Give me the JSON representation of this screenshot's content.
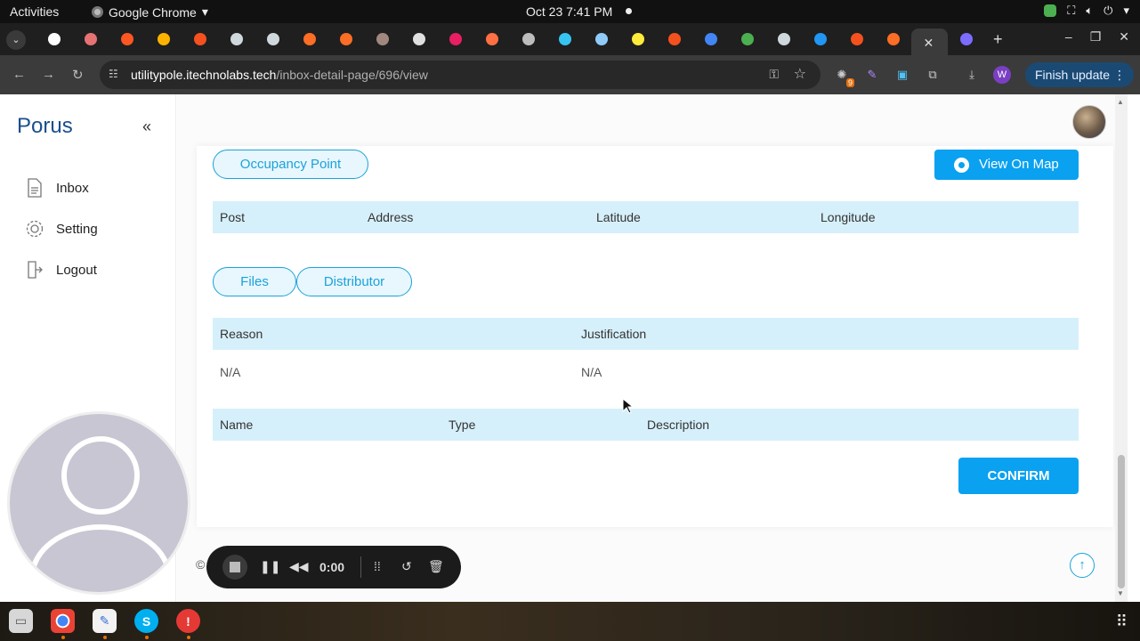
{
  "system_bar": {
    "activities": "Activities",
    "app_name": "Google Chrome",
    "app_menu_arrow": "▾",
    "clock": "Oct 23  7:41 PM",
    "tray_icons": [
      "shield-icon",
      "network-icon",
      "volume-icon",
      "power-icon"
    ]
  },
  "browser": {
    "tab_menu": "⌄",
    "tab_favicons": [
      {
        "color": "#ffffff"
      },
      {
        "color": "#e57373"
      },
      {
        "color": "#ff5722"
      },
      {
        "color": "#ffb300"
      },
      {
        "color": "#f4511e"
      },
      {
        "color": "#cfd8dc"
      },
      {
        "color": "#cfd8dc"
      },
      {
        "color": "#fc6d26"
      },
      {
        "color": "#fc6d26"
      },
      {
        "color": "#a1887f"
      },
      {
        "color": "#e0e0e0"
      },
      {
        "color": "#e91e63"
      },
      {
        "color": "#ff7043"
      },
      {
        "color": "#bdbdbd"
      },
      {
        "color": "#36c5f0"
      },
      {
        "color": "#90caf9"
      },
      {
        "color": "#ffeb3b"
      },
      {
        "color": "#f4511e"
      },
      {
        "color": "#4285f4"
      },
      {
        "color": "#4caf50"
      },
      {
        "color": "#cfd8dc"
      },
      {
        "color": "#2196f3"
      },
      {
        "color": "#f4511e"
      },
      {
        "color": "#fc6d26"
      }
    ],
    "active_tab_close": "✕",
    "newtab_label": "+",
    "window_controls": [
      "–",
      "❐",
      "✕"
    ],
    "back": "←",
    "forward": "→",
    "reload": "↻",
    "url_host": "utilitypole.itechnolabs.tech",
    "url_path": "/inbox-detail-page/696/view",
    "ext_badge": "9",
    "profile_letter": "W",
    "finish_update": "Finish update",
    "menu_dots": "⋮"
  },
  "sidebar": {
    "brand": "Porus",
    "collapse": "«",
    "items": [
      {
        "label": "Inbox"
      },
      {
        "label": "Setting"
      },
      {
        "label": "Logout"
      }
    ]
  },
  "main": {
    "occupancy_pill": "Occupancy Point",
    "view_on_map": "View On Map",
    "occupancy_table": {
      "headers": [
        "Post",
        "Address",
        "Latitude",
        "Longitude"
      ]
    },
    "tabs": [
      "Files",
      "Distributor"
    ],
    "reason_table": {
      "headers": [
        "Reason",
        "Justification"
      ],
      "rows": [
        [
          "N/A",
          "N/A"
        ]
      ]
    },
    "files_table": {
      "headers": [
        "Name",
        "Type",
        "Description"
      ]
    },
    "confirm": "CONFIRM",
    "footer_symbol": "©",
    "scroll_top": "↑"
  },
  "recorder": {
    "time": "0:00"
  },
  "colors": {
    "accent": "#0aa1f0",
    "pill_border": "#1aa3d9",
    "table_header_bg": "#d6f0fb",
    "brand": "#1a4f8c"
  }
}
